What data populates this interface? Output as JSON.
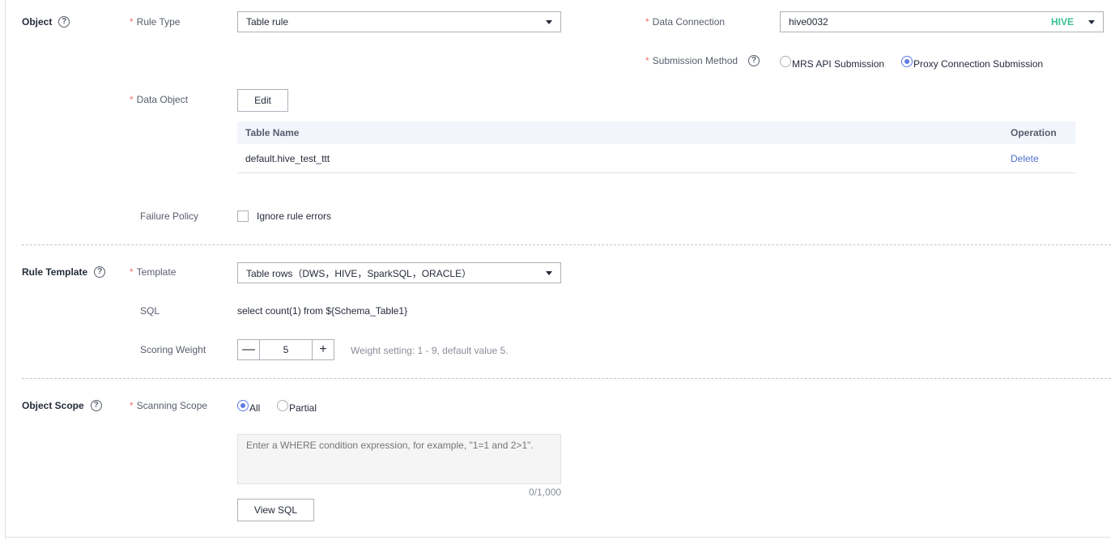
{
  "sections": {
    "object": {
      "title": "Object"
    },
    "rule_template": {
      "title": "Rule Template"
    },
    "object_scope": {
      "title": "Object Scope"
    }
  },
  "rule_type": {
    "label": "Rule Type",
    "value": "Table rule"
  },
  "data_connection": {
    "label": "Data Connection",
    "value": "hive0032",
    "tag": "HIVE"
  },
  "submission_method": {
    "label": "Submission Method",
    "options": [
      "MRS API Submission",
      "Proxy Connection Submission"
    ],
    "selected": "Proxy Connection Submission"
  },
  "data_object": {
    "label": "Data Object",
    "edit_label": "Edit",
    "table": {
      "columns": [
        "Table Name",
        "Operation"
      ],
      "rows": [
        {
          "name": "default.hive_test_ttt",
          "action": "Delete"
        }
      ]
    }
  },
  "failure_policy": {
    "label": "Failure Policy",
    "checkbox_label": "Ignore rule errors",
    "checked": false
  },
  "template": {
    "label": "Template",
    "value": "Table rows（DWS，HIVE，SparkSQL，ORACLE）"
  },
  "sql": {
    "label": "SQL",
    "value": "select count(1) from ${Schema_Table1}"
  },
  "scoring_weight": {
    "label": "Scoring Weight",
    "value": "5",
    "minus": "—",
    "plus": "+",
    "hint": "Weight setting: 1 - 9, default value 5."
  },
  "scanning_scope": {
    "label": "Scanning Scope",
    "options": [
      "All",
      "Partial"
    ],
    "selected": "All",
    "where_placeholder": "Enter a WHERE condition expression, for example, \"1=1 and 2>1\".",
    "counter": "0/1,000",
    "view_sql_label": "View SQL"
  },
  "colors": {
    "accent": "#5e7ce0",
    "required": "#f66f6a",
    "hive_tag": "#3ac295",
    "link": "#526ecc"
  },
  "icons": {
    "help": "question-circle-icon",
    "caret": "caret-down-icon"
  }
}
